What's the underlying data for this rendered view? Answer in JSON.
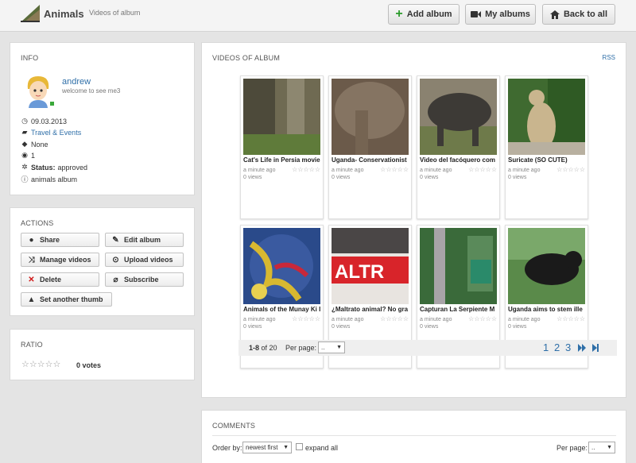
{
  "header": {
    "title": "Animals",
    "subtitle": "Videos of album",
    "buttons": {
      "add_album": "Add album",
      "my_albums": "My albums",
      "back_to_all": "Back to all"
    }
  },
  "info": {
    "section_title": "INFO",
    "username": "andrew",
    "user_status": "welcome to see me3",
    "date": "09.03.2013",
    "category": "Travel & Events",
    "tags": "None",
    "views": "1",
    "status_label": "Status:",
    "status_value": "approved",
    "description": "animals album"
  },
  "actions": {
    "section_title": "ACTIONS",
    "share": "Share",
    "edit_album": "Edit album",
    "manage_videos": "Manage videos",
    "upload_videos": "Upload videos",
    "delete": "Delete",
    "subscribe": "Subscribe",
    "set_thumb": "Set another thumb"
  },
  "ratio": {
    "section_title": "RATIO",
    "stars": "☆☆☆☆☆",
    "votes": "0 votes"
  },
  "videos": {
    "section_title": "VIDEOS OF ALBUM",
    "rss": "RSS",
    "items": [
      {
        "title": "Cat's Life in Persia movie",
        "time": "a minute ago",
        "views": "0 views",
        "stars": "☆☆☆☆☆"
      },
      {
        "title": "Uganda- Conservationist",
        "time": "a minute ago",
        "views": "0 views",
        "stars": "☆☆☆☆☆"
      },
      {
        "title": "Video del facóquero com",
        "time": "a minute ago",
        "views": "0 views",
        "stars": "☆☆☆☆☆"
      },
      {
        "title": "Suricate (SO CUTE)",
        "time": "a minute ago",
        "views": "0 views",
        "stars": "☆☆☆☆☆"
      },
      {
        "title": "Animals of the Munay Ki I",
        "time": "a minute ago",
        "views": "0 views",
        "stars": "☆☆☆☆☆"
      },
      {
        "title": "¿Maltrato animal? No gra",
        "time": "a minute ago",
        "views": "0 views",
        "stars": "☆☆☆☆☆"
      },
      {
        "title": "Capturan La Serpiente M",
        "time": "a minute ago",
        "views": "0 views",
        "stars": "☆☆☆☆☆"
      },
      {
        "title": "Uganda aims to stem ille",
        "time": "a minute ago",
        "views": "0 views",
        "stars": "☆☆☆☆☆"
      }
    ],
    "pager": {
      "count_bold": "1-8",
      "count_rest": " of 20",
      "per_page_label": "Per page:",
      "per_page_value": "..",
      "pages": [
        "1",
        "2",
        "3"
      ],
      "next": "⏩",
      "last": "⏭"
    }
  },
  "comments": {
    "section_title": "COMMENTS",
    "order_label": "Order by:",
    "order_value": "newest first",
    "expand_all": "expand all",
    "per_page_label": "Per page:",
    "per_page_value": ".."
  },
  "colors": {
    "link": "#2f6fa8",
    "add_icon": "#2a9a2a",
    "delete_icon": "#d01818"
  }
}
